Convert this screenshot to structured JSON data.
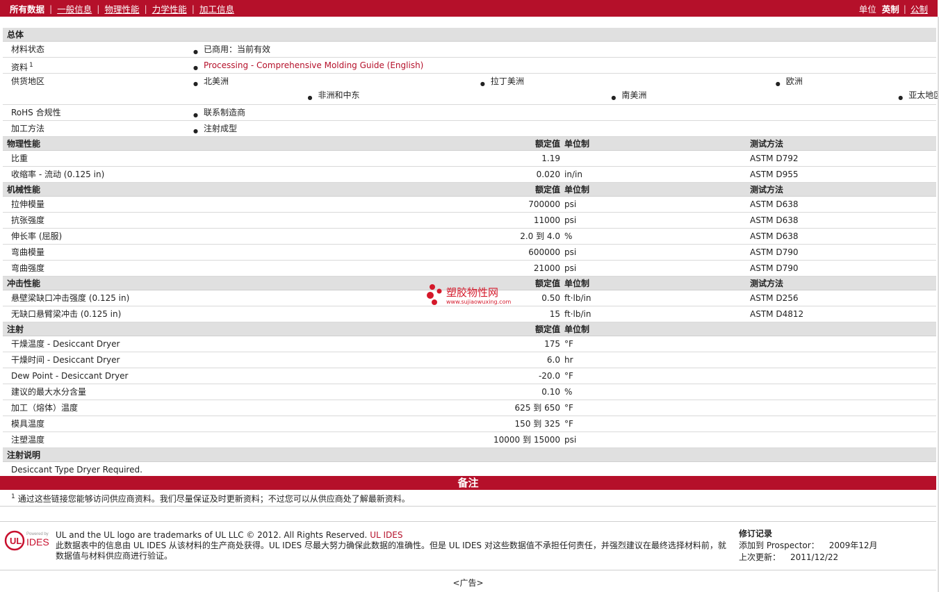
{
  "nav": {
    "tabs": [
      {
        "label": "所有数据"
      },
      {
        "label": "一般信息"
      },
      {
        "label": "物理性能"
      },
      {
        "label": "力学性能"
      },
      {
        "label": "加工信息"
      }
    ],
    "units_label": "单位",
    "unit_current": "英制",
    "unit_other": "公制"
  },
  "general": {
    "title": "总体",
    "status_label": "材料状态",
    "status_value": "已商用：当前有效",
    "docs_label": "资料",
    "docs_sup": "1",
    "docs_link": "Processing - Comprehensive Molding Guide (English)",
    "regions_label": "供货地区",
    "regions": [
      "北美洲",
      "拉丁美洲",
      "欧洲",
      "非洲和中东",
      "南美洲",
      "亚太地区"
    ],
    "rohs_label": "RoHS 合规性",
    "rohs_value": "联系制造商",
    "process_label": "加工方法",
    "process_value": "注射成型"
  },
  "headers": {
    "rated": "额定值",
    "unit": "单位制",
    "method": "测试方法"
  },
  "sections": {
    "physical": {
      "title": "物理性能",
      "rows": [
        {
          "label": "比重",
          "value": "1.19",
          "unit": "",
          "method": "ASTM D792"
        },
        {
          "label": "收缩率  - 流动  (0.125 in)",
          "value": "0.020",
          "unit": "in/in",
          "method": "ASTM D955"
        }
      ]
    },
    "mechanical": {
      "title": "机械性能",
      "rows": [
        {
          "label": "拉伸模量",
          "value": "700000",
          "unit": "psi",
          "method": "ASTM D638"
        },
        {
          "label": "抗张强度",
          "value": "11000",
          "unit": "psi",
          "method": "ASTM D638"
        },
        {
          "label": "伸长率  (屈服)",
          "value": "2.0 到  4.0",
          "unit": "%",
          "method": "ASTM D638"
        },
        {
          "label": "弯曲模量",
          "value": "600000",
          "unit": "psi",
          "method": "ASTM D790"
        },
        {
          "label": "弯曲强度",
          "value": "21000",
          "unit": "psi",
          "method": "ASTM D790"
        }
      ]
    },
    "impact": {
      "title": "冲击性能",
      "rows": [
        {
          "label": "悬壁梁缺口冲击强度  (0.125 in)",
          "value": "0.50",
          "unit": "ft·lb/in",
          "method": "ASTM D256"
        },
        {
          "label": "无缺口悬臂梁冲击  (0.125 in)",
          "value": "15",
          "unit": "ft·lb/in",
          "method": "ASTM D4812"
        }
      ]
    },
    "injection": {
      "title": "注射",
      "rows": [
        {
          "label": "干燥温度  - Desiccant Dryer",
          "value": "175",
          "unit": "°F"
        },
        {
          "label": "干燥时间  - Desiccant Dryer",
          "value": "6.0",
          "unit": "hr"
        },
        {
          "label": "Dew Point - Desiccant Dryer",
          "value": "-20.0",
          "unit": "°F"
        },
        {
          "label": "建议的最大水分含量",
          "value": "0.10",
          "unit": "%"
        },
        {
          "label": "加工（熔体）温度",
          "value": "625 到  650",
          "unit": "°F"
        },
        {
          "label": "模具温度",
          "value": "150 到  325",
          "unit": "°F"
        },
        {
          "label": "注塑温度",
          "value": "10000 到  15000",
          "unit": "psi"
        }
      ]
    },
    "injection_notes": {
      "title": "注射说明",
      "text": "Desiccant Type Dryer Required."
    }
  },
  "notes": {
    "title": "备注",
    "sup": "1",
    "text": "通过这些链接您能够访问供应商资料。我们尽量保证及时更新资料；不过您可以从供应商处了解最新资料。"
  },
  "watermark": {
    "title": "塑胶物性网",
    "url": "www.sujiaowuxing.com"
  },
  "footer": {
    "logo_small": "Powered by",
    "logo_text": "IDES",
    "trademark": "UL and the UL logo are trademarks of UL LLC © 2012. All Rights Reserved.",
    "trademark_link": "UL IDES",
    "disclaimer": "此数据表中的信息由  UL IDES 从该材料的生产商处获得。UL IDES 尽最大努力确保此数据的准确性。但是  UL IDES 对这些数据值不承担任何责任，并强烈建议在最终选择材料前，就数据值与材料供应商进行验证。",
    "record_title": "修订记录",
    "added_label": "添加到  Prospector：",
    "added_value": "2009年12月",
    "updated_label": "上次更新：",
    "updated_value": "2011/12/22",
    "ad": "<广告>"
  },
  "colors": {
    "brand": "#b5102a",
    "section_bg": "#e0e0e0"
  }
}
